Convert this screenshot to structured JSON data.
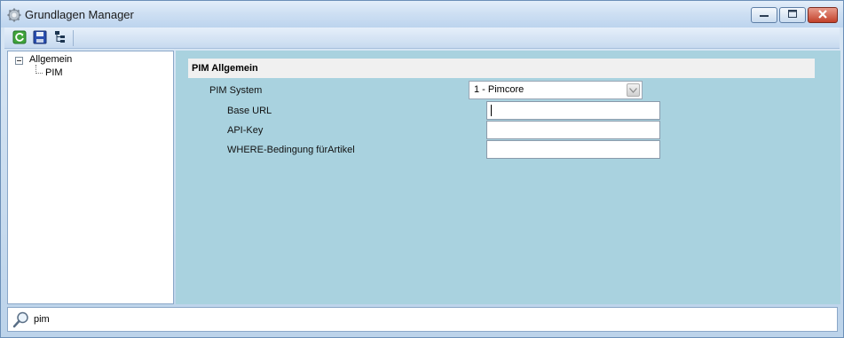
{
  "window": {
    "title": "Grundlagen Manager",
    "title_icon": "gear-icon"
  },
  "window_controls": {
    "minimize_icon": "minimize-icon",
    "maximize_icon": "maximize-icon",
    "close_icon": "close-icon"
  },
  "toolbar": {
    "buttons": [
      {
        "name": "refresh-button",
        "icon": "refresh-icon"
      },
      {
        "name": "save-button",
        "icon": "save-icon"
      },
      {
        "name": "tree-view-button",
        "icon": "tree-icon"
      }
    ]
  },
  "tree": {
    "root": "Allgemein",
    "children": [
      "PIM"
    ]
  },
  "section": {
    "title": "PIM Allgemein"
  },
  "form": {
    "pim_system": {
      "label": "PIM System",
      "value": "1 - Pimcore"
    },
    "base_url": {
      "label": "Base URL",
      "value": ""
    },
    "api_key": {
      "label": "API-Key",
      "value": ""
    },
    "where": {
      "label": "WHERE-Bedingung fürArtikel",
      "value": ""
    }
  },
  "search": {
    "value": "pim",
    "icon": "search-icon"
  },
  "colors": {
    "content_bg": "#a9d2df",
    "close_red": "#c2412a"
  }
}
